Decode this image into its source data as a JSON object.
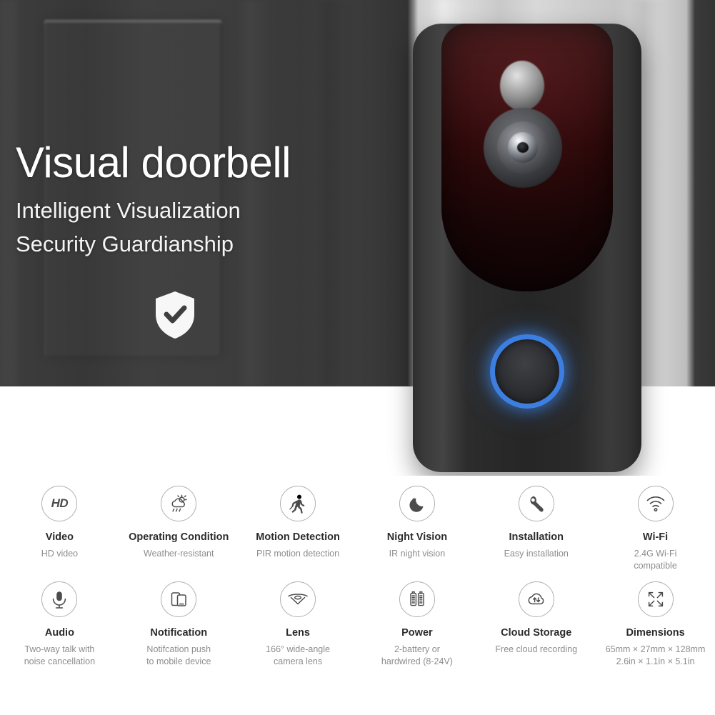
{
  "hero": {
    "title": "Visual doorbell",
    "subtitle_line1": "Intelligent Visualization",
    "subtitle_line2": "Security Guardianship",
    "badge_icon": "shield-check-icon"
  },
  "product": {
    "name": "video-doorbell",
    "led_ring_color": "#3d7fe0",
    "body_color": "#2c2c2c",
    "faceplate_color": "#2a0809"
  },
  "features": [
    {
      "icon": "hd-icon",
      "title": "Video",
      "desc": "HD video"
    },
    {
      "icon": "weather-sun-rain-icon",
      "title": "Operating Condition",
      "desc": "Weather-resistant"
    },
    {
      "icon": "walking-person-icon",
      "title": "Motion Detection",
      "desc": "PIR motion detection"
    },
    {
      "icon": "moon-stars-icon",
      "title": "Night Vision",
      "desc": "IR night vision"
    },
    {
      "icon": "wrench-icon",
      "title": "Installation",
      "desc": "Easy installation"
    },
    {
      "icon": "wifi-icon",
      "title": "Wi-Fi",
      "desc": "2.4G Wi-Fi\ncompatible"
    },
    {
      "icon": "microphone-icon",
      "title": "Audio",
      "desc": "Two-way talk with\nnoise cancellation"
    },
    {
      "icon": "mobile-devices-icon",
      "title": "Notification",
      "desc": "Notifcation push\nto mobile device"
    },
    {
      "icon": "wide-angle-lens-icon",
      "title": "Lens",
      "desc": "166° wide-angle\ncamera lens"
    },
    {
      "icon": "battery-pair-icon",
      "title": "Power",
      "desc": "2-battery or\nhardwired (8-24V)"
    },
    {
      "icon": "cloud-sync-icon",
      "title": "Cloud Storage",
      "desc": "Free cloud recording"
    },
    {
      "icon": "expand-arrows-icon",
      "title": "Dimensions",
      "desc": "65mm × 27mm × 128mm\n2.6in × 1.1in × 5.1in"
    }
  ]
}
